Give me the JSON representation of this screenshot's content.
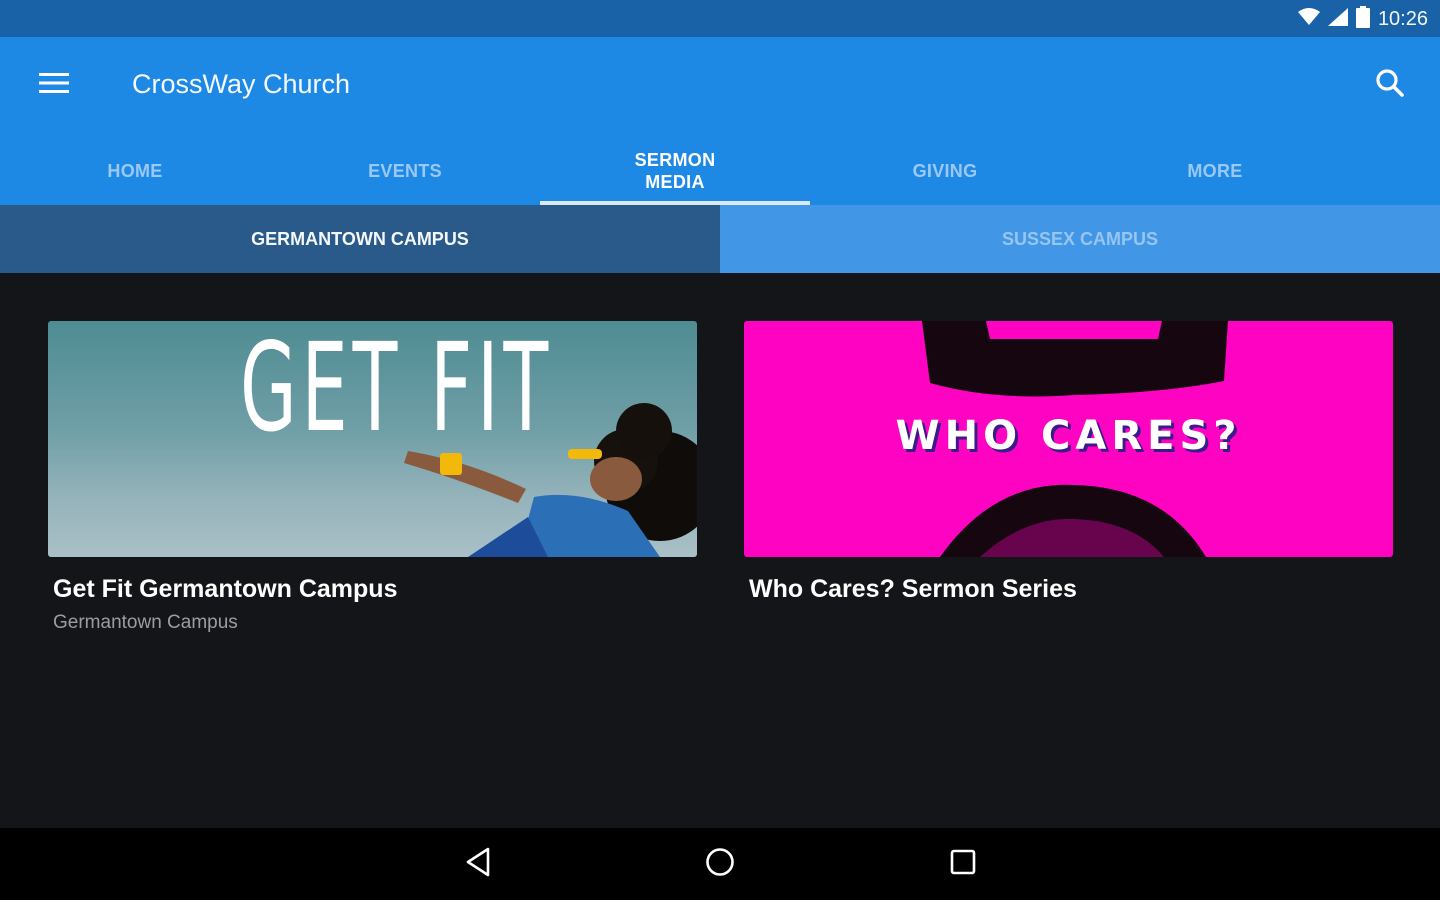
{
  "status_bar": {
    "time": "10:26",
    "icons": [
      "wifi-icon",
      "signal-icon",
      "battery-icon"
    ]
  },
  "app_bar": {
    "title": "CrossWay Church",
    "menu_icon": "hamburger-menu-icon",
    "search_icon": "search-icon",
    "color": "#1e88e5"
  },
  "tabs": [
    {
      "label": "HOME",
      "active": false
    },
    {
      "label": "EVENTS",
      "active": false
    },
    {
      "label": "SERMON\nMEDIA",
      "active": true
    },
    {
      "label": "GIVING",
      "active": false
    },
    {
      "label": "MORE",
      "active": false
    }
  ],
  "campus_tabs": [
    {
      "label": "GERMANTOWN CAMPUS",
      "active": true
    },
    {
      "label": "SUSSEX CAMPUS",
      "active": false
    }
  ],
  "cards": [
    {
      "image_text": "GET FIT",
      "title": "Get Fit Germantown Campus",
      "subtitle": "Germantown Campus"
    },
    {
      "image_text": "WHO CARES?",
      "title": "Who Cares? Sermon Series",
      "subtitle": ""
    }
  ],
  "nav_bar": {
    "icons": [
      "back-icon",
      "home-icon",
      "recents-icon"
    ]
  }
}
